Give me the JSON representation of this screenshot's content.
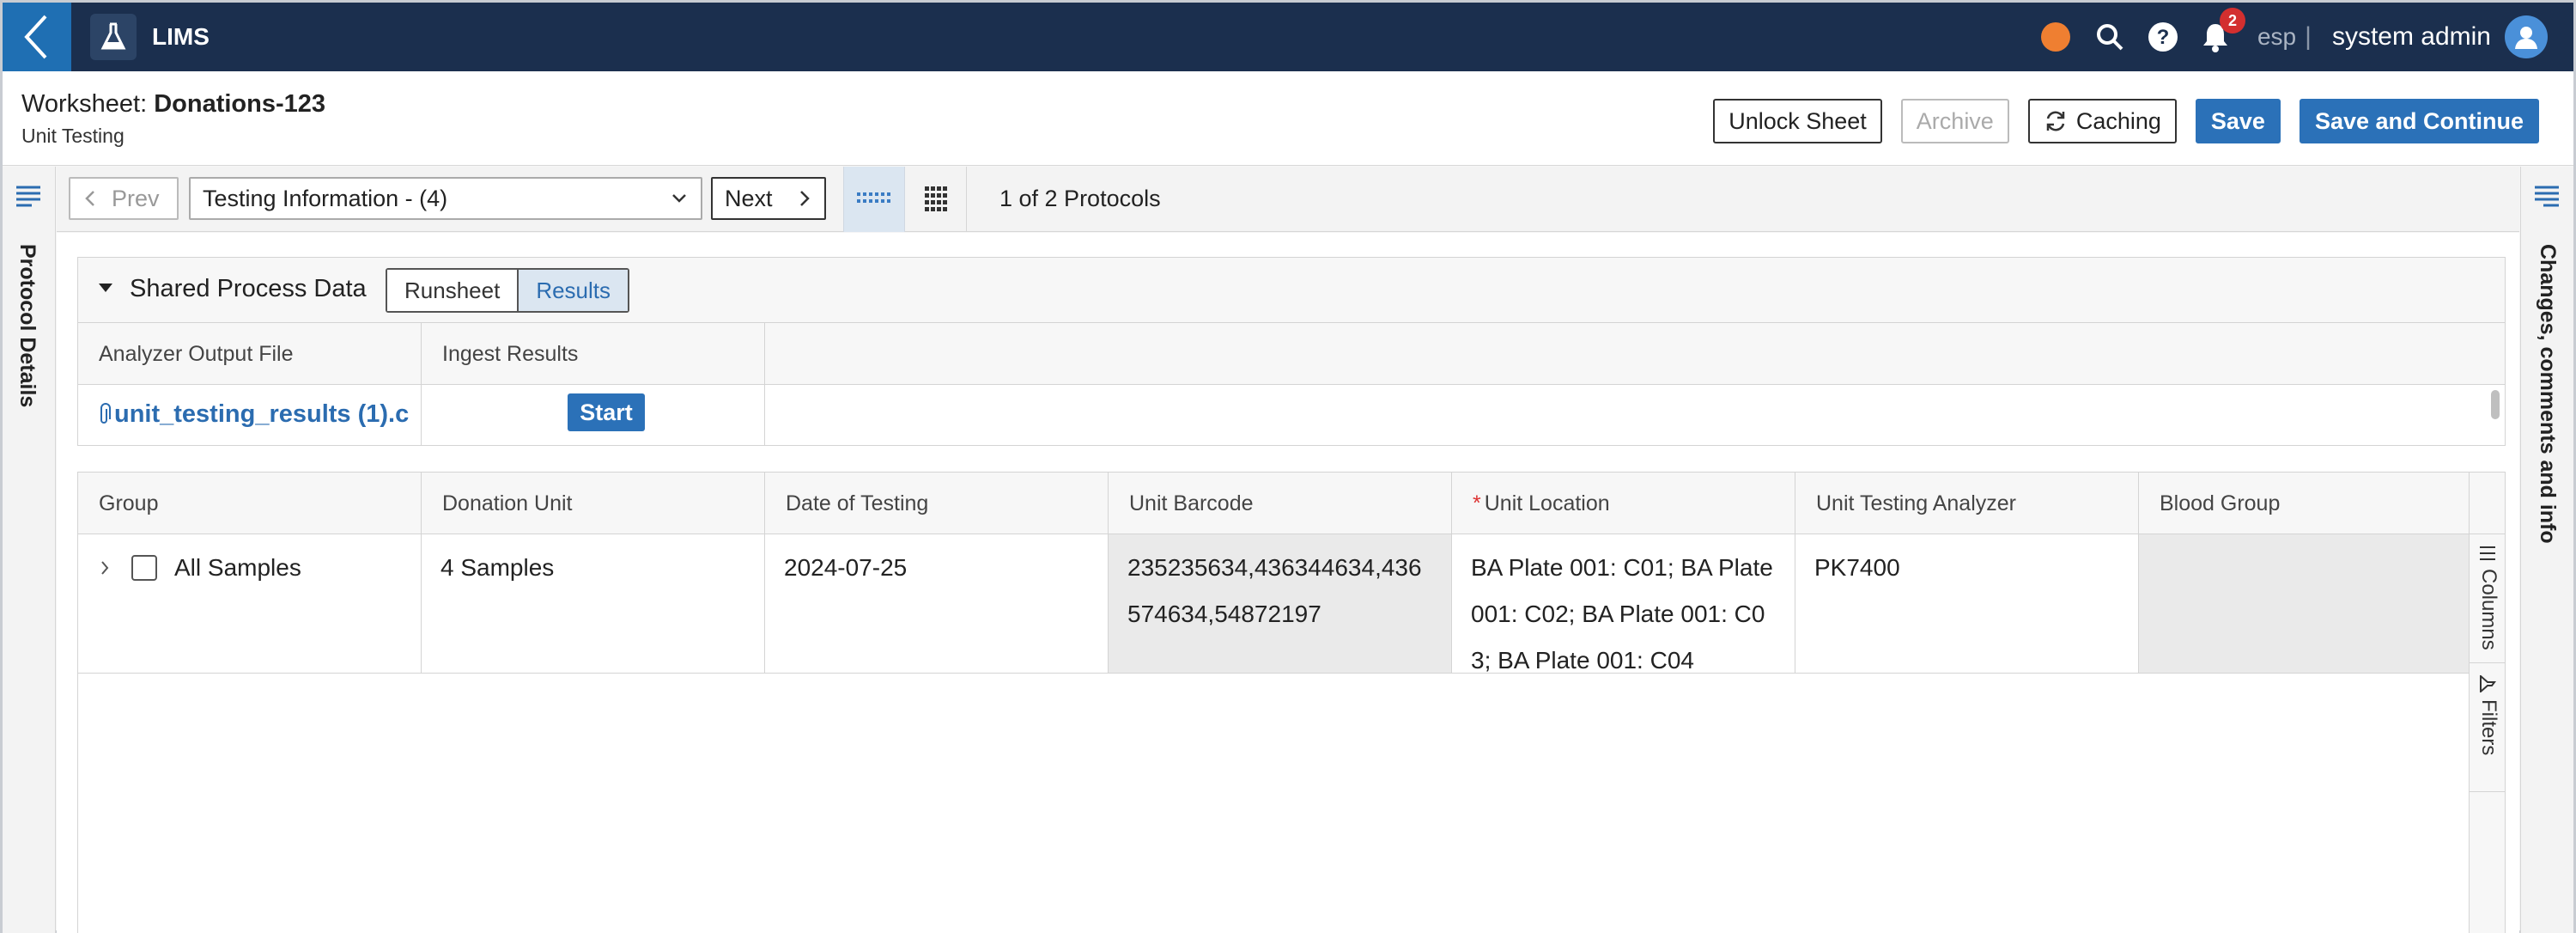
{
  "app": {
    "title": "LIMS",
    "tenant": "esp",
    "separator": "|",
    "user": "system admin",
    "notification_count": "2"
  },
  "header": {
    "worksheet_label": "Worksheet:",
    "worksheet_name": "Donations-123",
    "subtitle": "Unit Testing",
    "buttons": {
      "unlock": "Unlock Sheet",
      "archive": "Archive",
      "caching": "Caching",
      "save": "Save",
      "save_continue": "Save and Continue"
    }
  },
  "toolbar": {
    "prev": "Prev",
    "protocol_select": "Testing Information - (4)",
    "next": "Next",
    "protocol_count": "1 of 2 Protocols"
  },
  "left_rail": {
    "label": "Protocol Details"
  },
  "right_rail": {
    "label": "Changes, comments and info"
  },
  "shared": {
    "title": "Shared Process Data",
    "tabs": {
      "runsheet": "Runsheet",
      "results": "Results"
    },
    "columns": [
      "Analyzer Output File",
      "Ingest Results"
    ],
    "row": {
      "file": "unit_testing_results (1).c",
      "start": "Start"
    }
  },
  "grid": {
    "columns": [
      "Group",
      "Donation Unit",
      "Date of Testing",
      "Unit Barcode",
      "Unit Location",
      "Unit Testing Analyzer",
      "Blood Group"
    ],
    "row": {
      "group": "All Samples",
      "donation_unit": "4 Samples",
      "date": "2024-07-25",
      "barcode": "235235634,436344634,436574634,54872197",
      "location": "BA Plate 001: C01; BA Plate 001: C02; BA Plate 001: C03; BA Plate 001: C04",
      "analyzer": "PK7400",
      "blood_group": ""
    },
    "side_tools": {
      "columns": "Columns",
      "filters": "Filters"
    }
  },
  "colors": {
    "nav_bg": "#1b2f4e",
    "accent": "#2b71b8",
    "status_dot": "#ef7f31",
    "badge": "#d32f2f"
  }
}
